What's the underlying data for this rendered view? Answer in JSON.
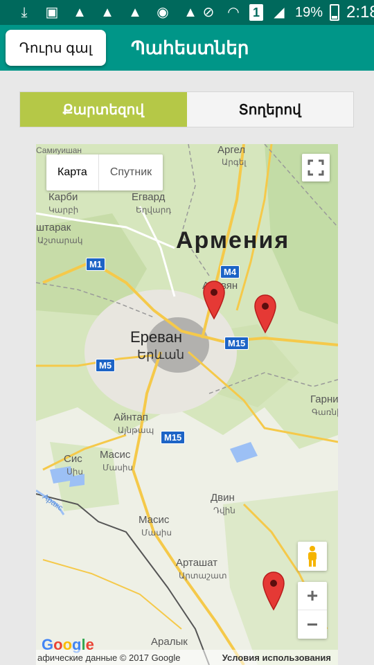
{
  "status_bar": {
    "icons": [
      "download-icon",
      "image-icon",
      "warning-icon",
      "warning-icon",
      "warning-icon",
      "chrome-icon",
      "warning-icon",
      "mute-icon",
      "wifi-icon",
      "sim-icon",
      "signal-icon",
      "battery-icon"
    ],
    "sim_label": "1",
    "battery": "19%",
    "time": "2:18"
  },
  "app_bar": {
    "back_label": "Դուրս գալ",
    "title": "Պահեստներ",
    "color": "#009688"
  },
  "tabs": [
    {
      "label": "Քարտեզով",
      "active": true
    },
    {
      "label": "Տողերով",
      "active": false
    }
  ],
  "map": {
    "type_map": "Карта",
    "type_satellite": "Спутник",
    "labels": {
      "armenia": "Армения",
      "yerevan_ru": "Ереван",
      "yerevan_hy": "Երևան",
      "argel_ru": "Аргел",
      "argel_hy": "Արգել",
      "egvard_ru": "Егвард",
      "egvard_hy": "Եղվարդ",
      "karbi_ru": "Карби",
      "karbi_hy": "Կարբի",
      "ashtarak_ru": "штарак",
      "ashtarak_hy": "Աշտարակ",
      "abovyan_ru": "Абовян",
      "ajntap_ru": "Айнтап",
      "ajntap_hy": "Այնթապ",
      "masis_ru": "Масис",
      "masis_hy": "Մասիս",
      "sis_ru": "Сис",
      "sis_hy": "Սիս",
      "dvin_ru": "Двин",
      "dvin_hy": "Դվին",
      "masis2_ru": "Масис",
      "masis2_hy": "Մասիս",
      "artashat_ru": "Арташат",
      "artashat_hy": "Արտաշատ",
      "aralyk_ru": "Аралык",
      "garni_ru": "Гарни",
      "garni_hy": "Գառնի",
      "araks": "Аракс",
      "top_label": "Самиуишан"
    },
    "shields": [
      "M1",
      "M4",
      "M15",
      "M5",
      "M15"
    ],
    "footer_copy": "афические данные © 2017 Google",
    "footer_terms": "Условия использования",
    "google": "Google"
  }
}
